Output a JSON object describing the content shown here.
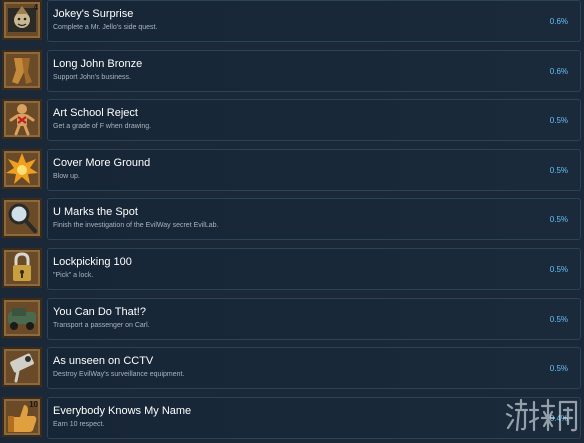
{
  "achievements": [
    {
      "title": "Jokey's Surprise",
      "description": "Complete a Mr. Jello's side quest.",
      "percent": "0.6%",
      "icon": "jester-icon",
      "icon_badge": "4"
    },
    {
      "title": "Long John Bronze",
      "description": "Support John's business.",
      "percent": "0.6%",
      "icon": "underwear-icon"
    },
    {
      "title": "Art School Reject",
      "description": "Get a grade of F when drawing.",
      "percent": "0.5%",
      "icon": "voodoo-doll-icon"
    },
    {
      "title": "Cover More Ground",
      "description": "Blow up.",
      "percent": "0.5%",
      "icon": "explosion-icon"
    },
    {
      "title": "U Marks the Spot",
      "description": "Finish the investigation of the EvilWay secret EvilLab.",
      "percent": "0.5%",
      "icon": "magnifying-glass-icon"
    },
    {
      "title": "Lockpicking 100",
      "description": "\"Pick\" a lock.",
      "percent": "0.5%",
      "icon": "padlock-icon"
    },
    {
      "title": "You Can Do That!?",
      "description": "Transport a passenger on Carl.",
      "percent": "0.5%",
      "icon": "vehicle-icon"
    },
    {
      "title": "As unseen on CCTV",
      "description": "Destroy EvilWay's surveillance equipment.",
      "percent": "0.5%",
      "icon": "camera-icon"
    },
    {
      "title": "Everybody Knows My Name",
      "description": "Earn 10 respect.",
      "percent": "0.4%",
      "icon": "thumbs-up-icon",
      "icon_badge": "10"
    }
  ],
  "watermark": {
    "text": "游侠网"
  },
  "colors": {
    "background": "#1b2838",
    "percent": "#66c0f4",
    "panel_border": "#2b4359"
  }
}
